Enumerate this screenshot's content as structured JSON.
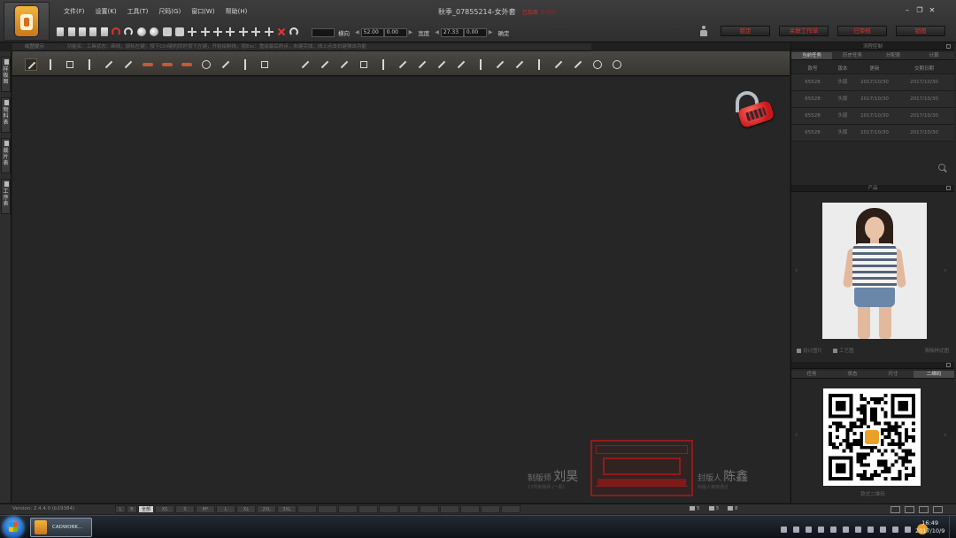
{
  "app": {
    "menu": [
      "文件(F)",
      "设置(K)",
      "工具(T)",
      "尺码(G)",
      "窗口(W)",
      "帮助(H)"
    ],
    "title": "秋季_07855214-女外套",
    "title_status": "已加密",
    "title_status_2": "未审核"
  },
  "toolbar": {
    "param_dir_label": "横向",
    "param_dir_value": "",
    "param_val1": "52.00",
    "param_val2": "0.00",
    "param_width_label": "宽度",
    "param_val3": "27.33",
    "param_val4": "0.00",
    "confirm_label": "确定",
    "status_buttons": [
      "锁定",
      "关联工作单",
      "已审核",
      "锁图"
    ]
  },
  "left_tabs": [
    "样板图",
    "物料表",
    "裁片表",
    "工序表"
  ],
  "panel_header": {
    "title": "绘图提示",
    "hint": "功能名：工具状态：画线，鼠标左键：按下Ctrl键的同时按下左键，开始绘制线，按Esc：重绘最后的点，右键完成，线上点击右键弹出功能"
  },
  "signatures": {
    "maker_label": "制版师",
    "maker_name": "刘昊",
    "maker_sub": "13号制版师  (一般)",
    "reviewer_label": "封版人",
    "reviewer_name": "陈鑫",
    "reviewer_sub": "封版人审核通过"
  },
  "right_panel": {
    "process_header": "流程控制",
    "process_tabs": [
      "当前任务",
      "历史任务",
      "分配表",
      "计算"
    ],
    "table_headers": [
      "款号",
      "版本",
      "更新",
      "交期日期"
    ],
    "table_rows": [
      [
        "65528",
        "头版",
        "2017/10/30",
        "2017/10/30"
      ],
      [
        "65528",
        "头版",
        "2017/10/30",
        "2017/10/30"
      ],
      [
        "65528",
        "头版",
        "2017/10/30",
        "2017/10/30"
      ],
      [
        "65528",
        "头版",
        "2017/10/30",
        "2017/10/30"
      ]
    ],
    "product_header": "产品",
    "photo_actions": [
      "设计图片",
      "工艺图"
    ],
    "photo_action_right": "清除样式图",
    "info_tabs": [
      "任务",
      "状态",
      "尺寸",
      "二维码"
    ],
    "qr_caption": "款式二维码"
  },
  "bottombar": {
    "version": "Version: 2.4.4.0 (b19384)",
    "sizes": [
      "L",
      "B",
      "全部",
      "XS",
      "S",
      "M*",
      "L",
      "XL",
      "2XL",
      "3XL"
    ],
    "selected_size": "全部",
    "counters": [
      "5",
      "3",
      "8"
    ]
  },
  "taskbar": {
    "app_label": "CADWORK...",
    "time": "16:49",
    "date": "2017/10/9"
  },
  "colors": {
    "accent_red": "#d6342e",
    "panel_bg": "#262626",
    "toolbar_bg": "#3d3d3d"
  }
}
